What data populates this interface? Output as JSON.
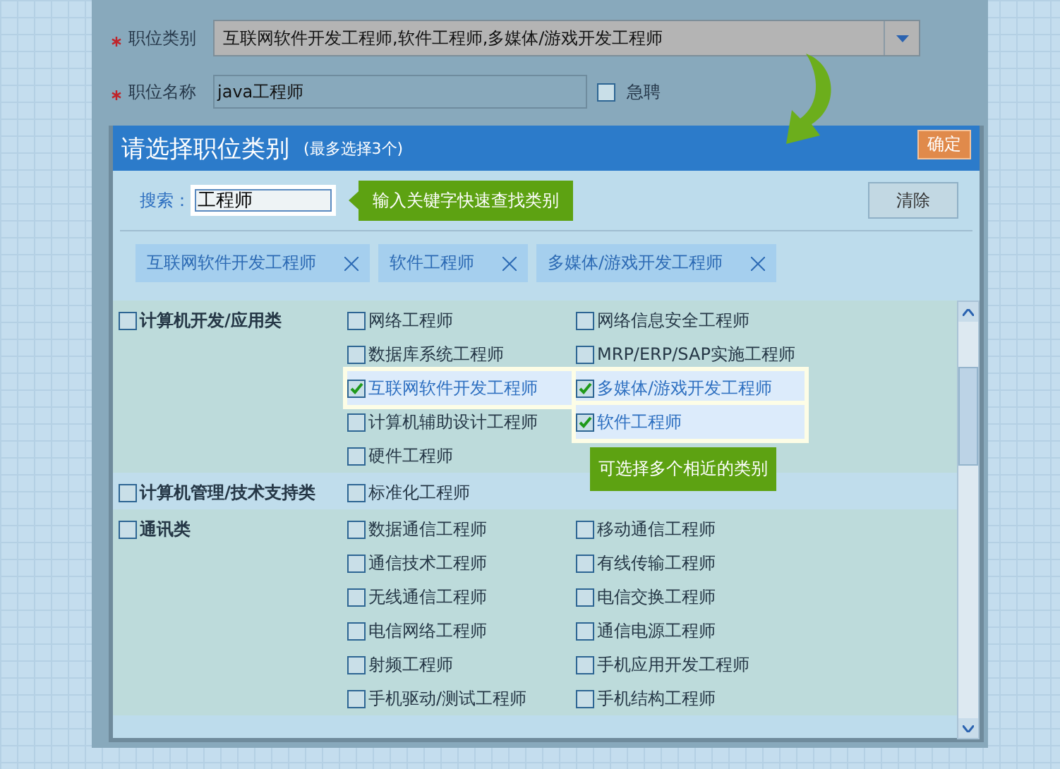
{
  "form": {
    "fields": [
      {
        "kind": "select",
        "label": "职位类别",
        "required": true,
        "value": "互联网软件开发工程师,软件工程师,多媒体/游戏开发工程师"
      },
      {
        "kind": "text",
        "label": "职位名称",
        "required": true,
        "value": "java工程师"
      }
    ],
    "urgent": {
      "label": "急聘",
      "checked": false
    }
  },
  "dialog": {
    "title": "请选择职位类别",
    "subtitle": "(最多选择3个)",
    "confirm_button": "确定",
    "search": {
      "label": "搜索：",
      "value": "工程师"
    },
    "hint": "输入关键字快速查找类别",
    "clear_button": "清除",
    "selected_tags": [
      "互联网软件开发工程师",
      "软件工程师",
      "多媒体/游戏开发工程师"
    ],
    "categories": [
      {
        "name": "计算机开发/应用类",
        "checked": false,
        "items": [
          {
            "label": "网络工程师",
            "checked": false
          },
          {
            "label": "网络信息安全工程师",
            "checked": false
          },
          {
            "label": "数据库系统工程师",
            "checked": false
          },
          {
            "label": "MRP/ERP/SAP实施工程师",
            "checked": false
          },
          {
            "label": "互联网软件开发工程师",
            "checked": true
          },
          {
            "label": "多媒体/游戏开发工程师",
            "checked": true
          },
          {
            "label": "计算机辅助设计工程师",
            "checked": false
          },
          {
            "label": "软件工程师",
            "checked": true
          },
          {
            "label": "硬件工程师",
            "checked": false
          }
        ]
      },
      {
        "name": "计算机管理/技术支持类",
        "checked": false,
        "items": [
          {
            "label": "标准化工程师",
            "checked": false
          }
        ]
      },
      {
        "name": "通讯类",
        "checked": false,
        "items": [
          {
            "label": "数据通信工程师",
            "checked": false
          },
          {
            "label": "移动通信工程师",
            "checked": false
          },
          {
            "label": "通信技术工程师",
            "checked": false
          },
          {
            "label": "有线传输工程师",
            "checked": false
          },
          {
            "label": "无线通信工程师",
            "checked": false
          },
          {
            "label": "电信交换工程师",
            "checked": false
          },
          {
            "label": "电信网络工程师",
            "checked": false
          },
          {
            "label": "通信电源工程师",
            "checked": false
          },
          {
            "label": "射频工程师",
            "checked": false
          },
          {
            "label": "手机应用开发工程师",
            "checked": false
          },
          {
            "label": "手机驱动/测试工程师",
            "checked": false
          },
          {
            "label": "手机结构工程师",
            "checked": false
          }
        ]
      }
    ],
    "tip": "可选择多个相近的类别"
  }
}
